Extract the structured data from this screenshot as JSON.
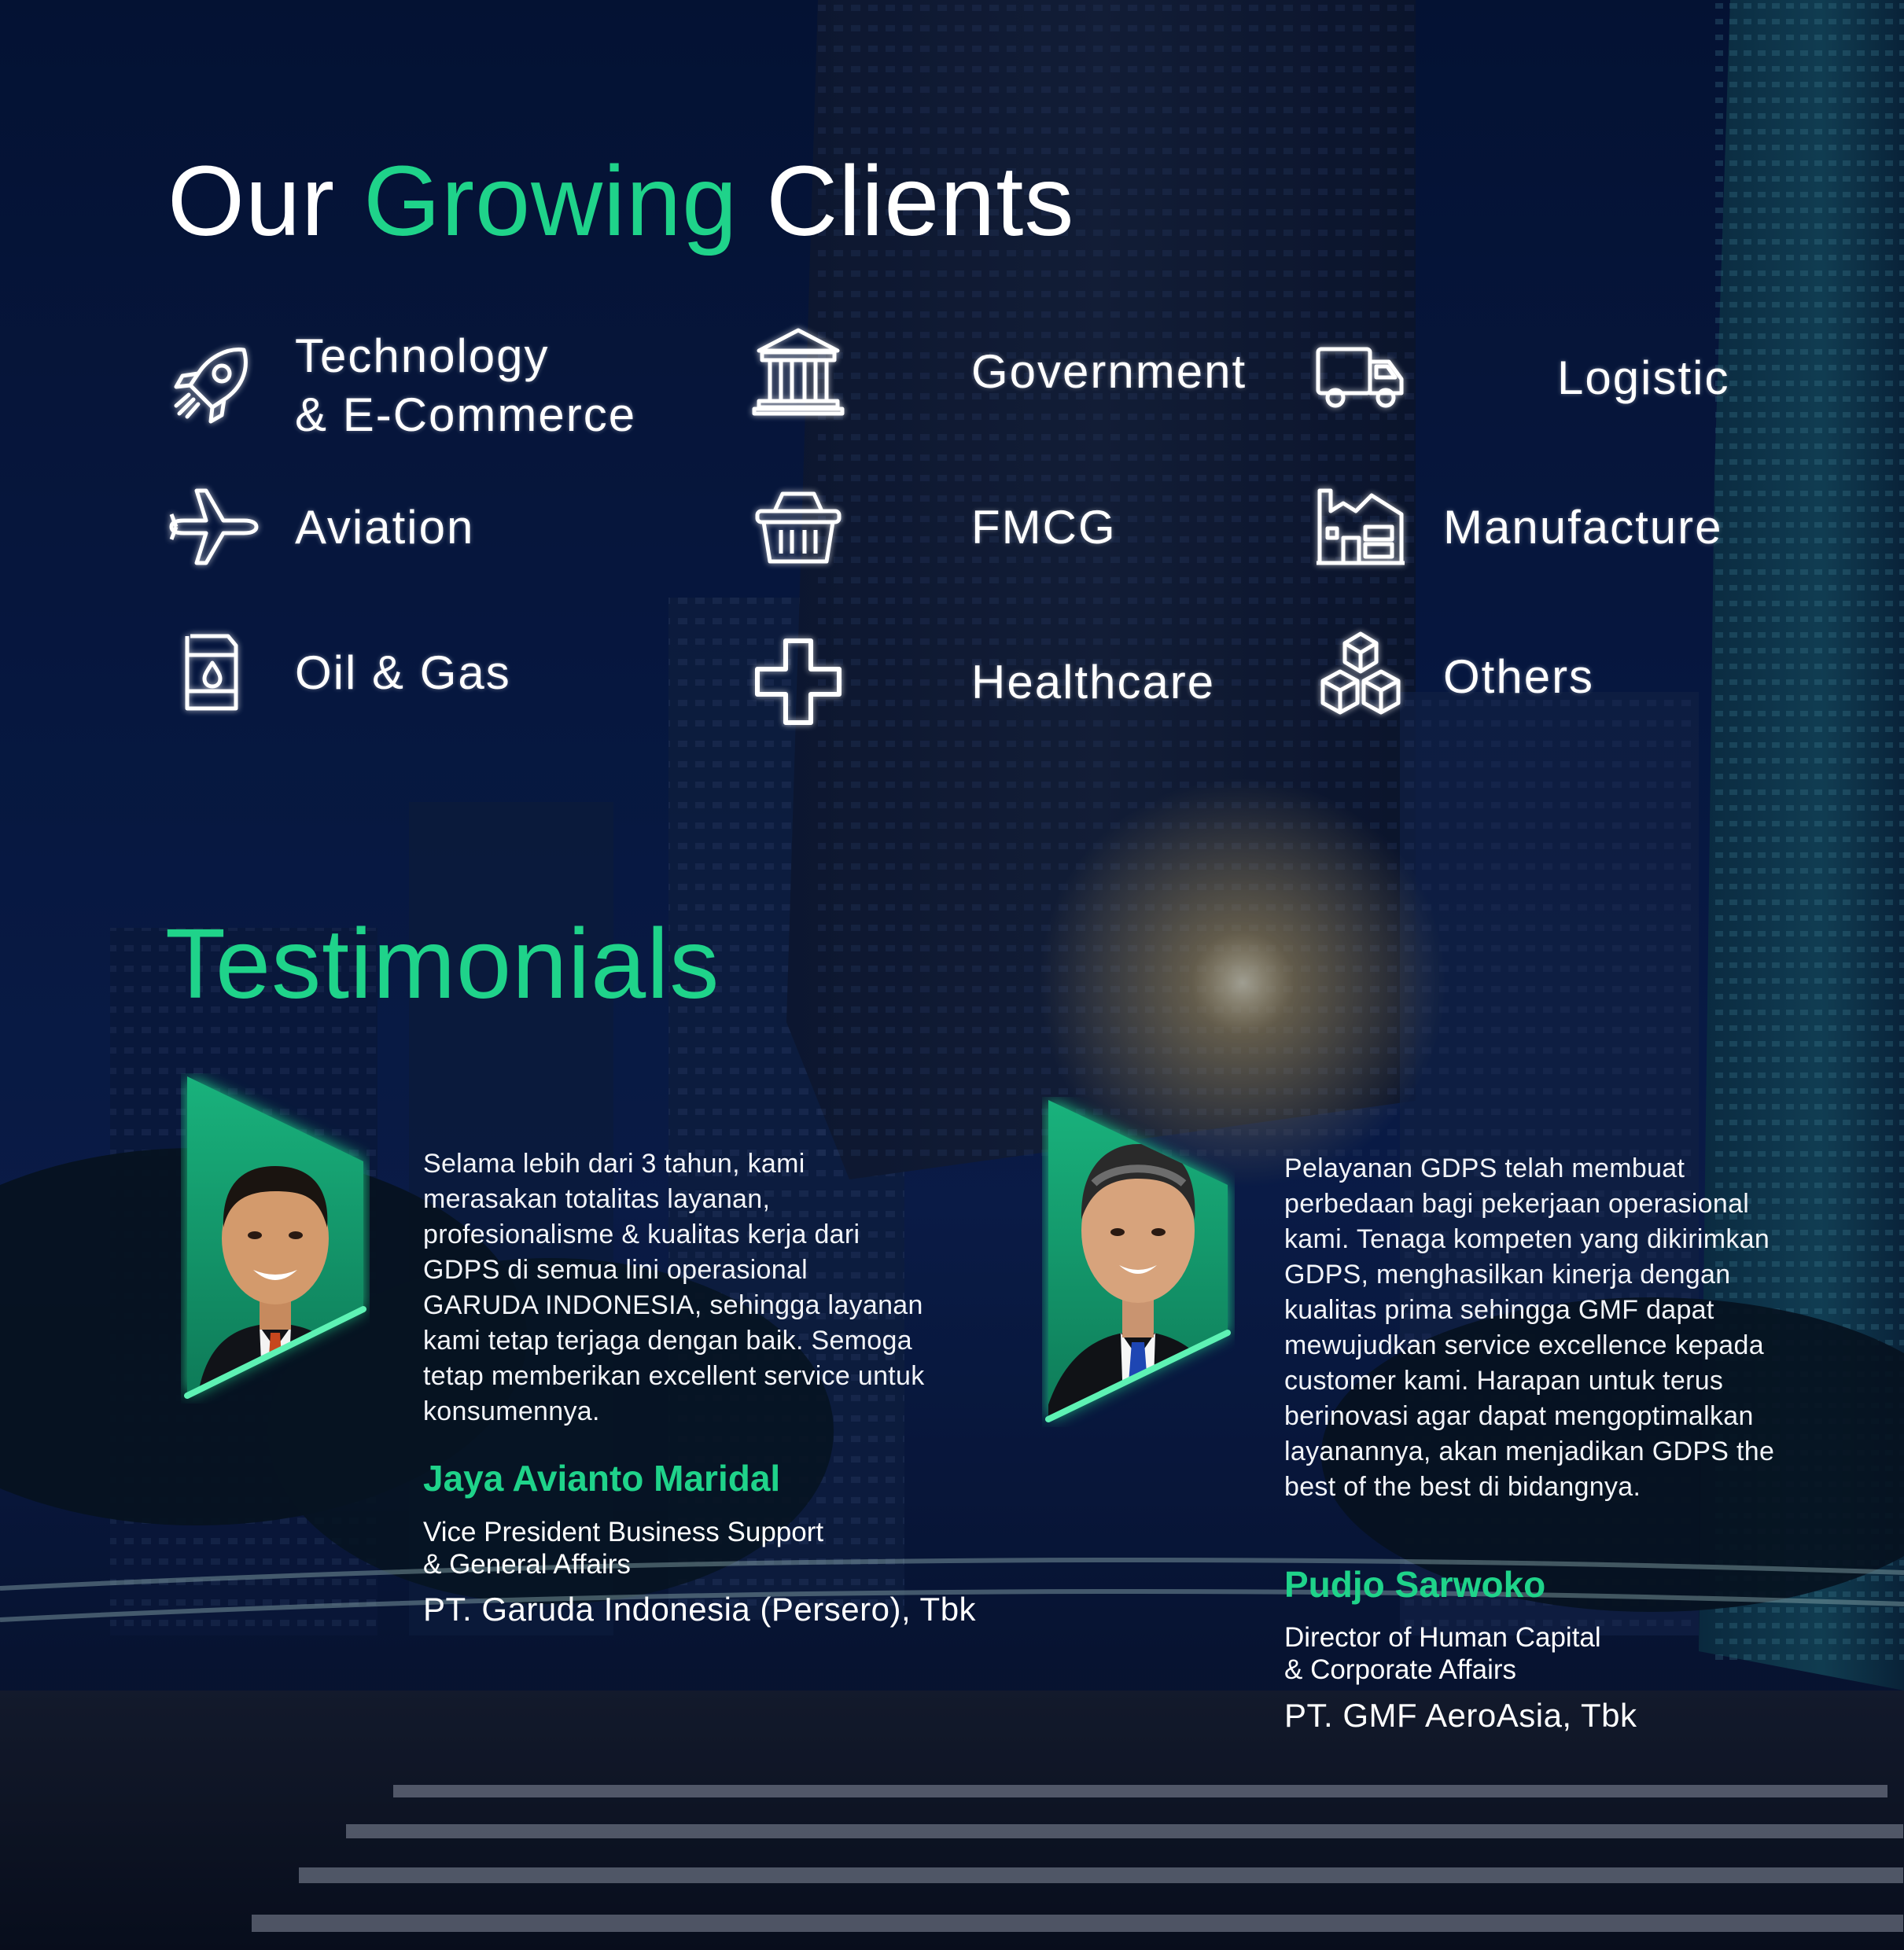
{
  "header": {
    "title_part1": "Our ",
    "title_accent": "Growing",
    "title_part2": " Clients"
  },
  "colors": {
    "accent": "#1fd38a",
    "background_dark": "#06122e",
    "text": "#ffffff"
  },
  "categories": [
    {
      "label": "Technology\n& E-Commerce",
      "icon": "rocket-icon"
    },
    {
      "label": "Government",
      "icon": "government-building-icon"
    },
    {
      "label": "Logistic",
      "icon": "truck-icon"
    },
    {
      "label": "Aviation",
      "icon": "airplane-icon"
    },
    {
      "label": "FMCG",
      "icon": "basket-icon"
    },
    {
      "label": "Manufacture",
      "icon": "factory-icon"
    },
    {
      "label": "Oil & Gas",
      "icon": "oil-barrel-icon"
    },
    {
      "label": "Healthcare",
      "icon": "medical-cross-icon"
    },
    {
      "label": "Others",
      "icon": "boxes-icon"
    }
  ],
  "testimonials": {
    "title": "Testimonials",
    "items": [
      {
        "quote": "Selama lebih dari 3 tahun, kami merasakan totalitas layanan, profesionalisme & kualitas kerja dari GDPS di semua lini operasional GARUDA INDONESIA, sehingga layanan kami tetap terjaga dengan baik. Semoga tetap memberikan excellent service untuk konsumennya.",
        "name": "Jaya Avianto Maridal",
        "role": "Vice President Business Support\n& General Affairs",
        "company": "PT. Garuda Indonesia (Persero), Tbk"
      },
      {
        "quote": "Pelayanan GDPS telah membuat perbedaan bagi pekerjaan operasional kami. Tenaga kompeten yang dikirimkan GDPS, menghasilkan kinerja dengan kualitas prima sehingga GMF dapat mewujudkan service excellence kepada customer kami. Harapan untuk terus berinovasi agar dapat mengoptimalkan layanannya, akan menjadikan GDPS the best of the best di bidangnya.",
        "name": "Pudjo Sarwoko",
        "role": "Director of Human Capital\n& Corporate Affairs",
        "company": "PT. GMF AeroAsia, Tbk"
      }
    ]
  }
}
